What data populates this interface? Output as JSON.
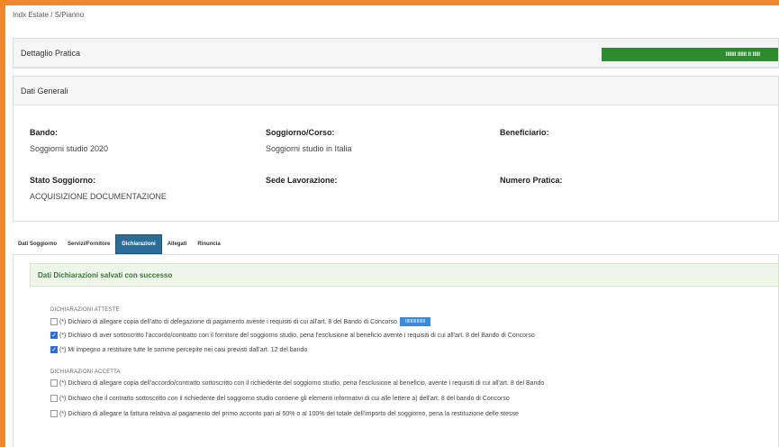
{
  "breadcrumb": "Indx Estate / S/Pianno",
  "detail_panel": {
    "title": "Dettaglio Pratica",
    "button_label": "IIIIIII IIIIII II IIIII"
  },
  "general_panel": {
    "title": "Dati Generali",
    "fields": {
      "bando_label": "Bando:",
      "bando_value": "Soggiorni studio 2020",
      "soggiorno_label": "Soggiorno/Corso:",
      "soggiorno_value": "Soggiorni studio in Italia",
      "beneficiario_label": "Beneficiario:",
      "stato_label": "Stato Soggiorno:",
      "stato_value": "ACQUISIZIONE DOCUMENTAZIONE",
      "sede_label": "Sede Lavorazione:",
      "numero_label": "Numero Pratica:"
    }
  },
  "tabs": [
    "Dati Soggiorno",
    "Servizi/Fornitore",
    "Dichiarazioni",
    "Allegati",
    "Rinuncia"
  ],
  "alert": "Dati Dichiarazioni salvati con successo",
  "section1": {
    "title": "DICHIARAZIONI ATTESTE",
    "rows": [
      {
        "text": "(*) Dichiaro di allegare copia dell'atto di delegazione di pagamento avente i requisiti di cui all'art. 8 del Bando di Concorso",
        "checked": false,
        "button": "IIIIIIIIIIIIIIII"
      },
      {
        "text": "(*) Dichiaro di aver sottoscritto l'accordo/contratto con il fornitore del soggiorno studio, pena l'esclusione al beneficio avente i requisiti di cui all'art. 8 del Bando di Concorso",
        "checked": true
      },
      {
        "text": "(*) Mi impegno a restituire tutte le somme percepite nei casi previsti dall'art. 12 del bando",
        "checked": true
      }
    ]
  },
  "section2": {
    "title": "DICHIARAZIONI ACCETTA",
    "rows": [
      {
        "text": "(*) Dichiaro di allegare copia dell'accordo/contratto sottoscritto con il richiedente del soggiorno studio, pena l'esclusione al beneficio, avente i requisiti di cui all'art. 8 del Bando",
        "checked": false
      },
      {
        "text": "(*) Dichiaro che il contratto sottoscritto con il richiedente del soggiorno studio contiene gli elementi informativi di cui alle lettere a) dell'art. 8 del bando di Concorso",
        "checked": false
      },
      {
        "text": "(*) Dichiaro di allegare la fattura relativa al pagamento del primo acconto pari al 50% o al 100% del totale dell'importo del soggiorno, pena la restituzione delle stesse",
        "checked": false
      }
    ]
  }
}
